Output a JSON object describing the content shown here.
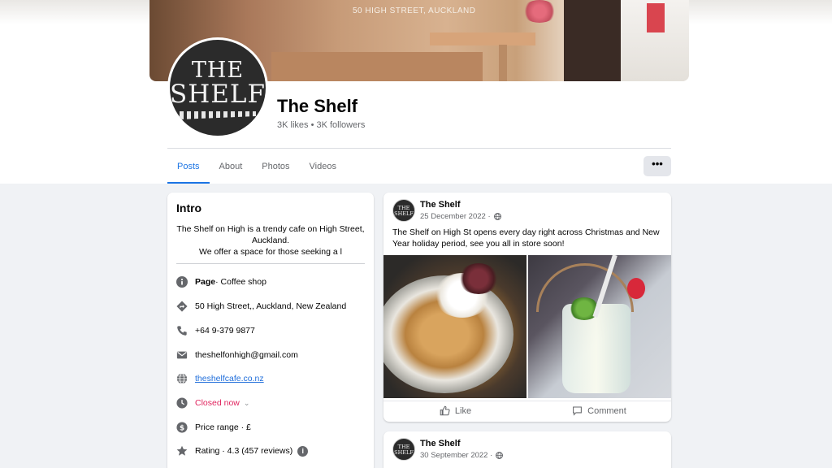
{
  "cover": {
    "sign_text": "50 HIGH STREET, AUCKLAND"
  },
  "profile": {
    "logo_line1": "THE",
    "logo_line2": "SHELF",
    "name": "The Shelf",
    "stats": "3K likes • 3K followers"
  },
  "tabs": [
    {
      "label": "Posts",
      "active": true
    },
    {
      "label": "About",
      "active": false
    },
    {
      "label": "Photos",
      "active": false
    },
    {
      "label": "Videos",
      "active": false
    }
  ],
  "more_button": "•••",
  "intro": {
    "title": "Intro",
    "description_line1": "The Shelf on High is a trendy cafe on High Street,",
    "description_line2": "Auckland.",
    "description_line3": "We offer a space for those seeking a l",
    "page_label": "Page",
    "page_category": " · Coffee shop",
    "address": "50 High Street,, Auckland, New Zealand",
    "phone": "+64 9-379 9877",
    "email": "theshelfonhigh@gmail.com",
    "website": "theshelfcafe.co.nz",
    "hours_status": "Closed now",
    "hours_caret": "⌄",
    "price_range": "Price range · £",
    "rating": "Rating · 4.3 (457 reviews)",
    "rating_info": "i"
  },
  "icons": {
    "info": "info-icon",
    "address": "directions-icon",
    "phone": "phone-icon",
    "email": "mail-icon",
    "website": "globe-icon",
    "hours": "clock-icon",
    "price": "dollar-icon",
    "rating": "star-icon"
  },
  "colors": {
    "accent": "#1b74e4",
    "closed": "#e0245e",
    "link": "#216fdb"
  },
  "posts": [
    {
      "author": "The Shelf",
      "date": "25 December 2022 ·",
      "text": "The Shelf on High St opens every day right across Christmas and New Year holiday period, see you all in store soon!",
      "like_label": "Like",
      "comment_label": "Comment"
    },
    {
      "author": "The Shelf",
      "date": "30 September 2022 ·"
    }
  ],
  "avatar_text": "THE SHELF"
}
